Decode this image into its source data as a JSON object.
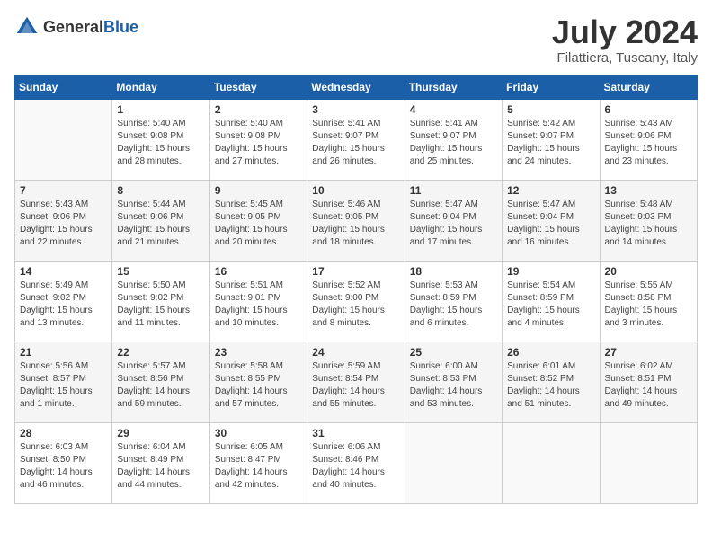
{
  "header": {
    "logo_general": "General",
    "logo_blue": "Blue",
    "month_year": "July 2024",
    "location": "Filattiera, Tuscany, Italy"
  },
  "days_of_week": [
    "Sunday",
    "Monday",
    "Tuesday",
    "Wednesday",
    "Thursday",
    "Friday",
    "Saturday"
  ],
  "weeks": [
    [
      {
        "num": "",
        "info": ""
      },
      {
        "num": "1",
        "info": "Sunrise: 5:40 AM\nSunset: 9:08 PM\nDaylight: 15 hours\nand 28 minutes."
      },
      {
        "num": "2",
        "info": "Sunrise: 5:40 AM\nSunset: 9:08 PM\nDaylight: 15 hours\nand 27 minutes."
      },
      {
        "num": "3",
        "info": "Sunrise: 5:41 AM\nSunset: 9:07 PM\nDaylight: 15 hours\nand 26 minutes."
      },
      {
        "num": "4",
        "info": "Sunrise: 5:41 AM\nSunset: 9:07 PM\nDaylight: 15 hours\nand 25 minutes."
      },
      {
        "num": "5",
        "info": "Sunrise: 5:42 AM\nSunset: 9:07 PM\nDaylight: 15 hours\nand 24 minutes."
      },
      {
        "num": "6",
        "info": "Sunrise: 5:43 AM\nSunset: 9:06 PM\nDaylight: 15 hours\nand 23 minutes."
      }
    ],
    [
      {
        "num": "7",
        "info": "Sunrise: 5:43 AM\nSunset: 9:06 PM\nDaylight: 15 hours\nand 22 minutes."
      },
      {
        "num": "8",
        "info": "Sunrise: 5:44 AM\nSunset: 9:06 PM\nDaylight: 15 hours\nand 21 minutes."
      },
      {
        "num": "9",
        "info": "Sunrise: 5:45 AM\nSunset: 9:05 PM\nDaylight: 15 hours\nand 20 minutes."
      },
      {
        "num": "10",
        "info": "Sunrise: 5:46 AM\nSunset: 9:05 PM\nDaylight: 15 hours\nand 18 minutes."
      },
      {
        "num": "11",
        "info": "Sunrise: 5:47 AM\nSunset: 9:04 PM\nDaylight: 15 hours\nand 17 minutes."
      },
      {
        "num": "12",
        "info": "Sunrise: 5:47 AM\nSunset: 9:04 PM\nDaylight: 15 hours\nand 16 minutes."
      },
      {
        "num": "13",
        "info": "Sunrise: 5:48 AM\nSunset: 9:03 PM\nDaylight: 15 hours\nand 14 minutes."
      }
    ],
    [
      {
        "num": "14",
        "info": "Sunrise: 5:49 AM\nSunset: 9:02 PM\nDaylight: 15 hours\nand 13 minutes."
      },
      {
        "num": "15",
        "info": "Sunrise: 5:50 AM\nSunset: 9:02 PM\nDaylight: 15 hours\nand 11 minutes."
      },
      {
        "num": "16",
        "info": "Sunrise: 5:51 AM\nSunset: 9:01 PM\nDaylight: 15 hours\nand 10 minutes."
      },
      {
        "num": "17",
        "info": "Sunrise: 5:52 AM\nSunset: 9:00 PM\nDaylight: 15 hours\nand 8 minutes."
      },
      {
        "num": "18",
        "info": "Sunrise: 5:53 AM\nSunset: 8:59 PM\nDaylight: 15 hours\nand 6 minutes."
      },
      {
        "num": "19",
        "info": "Sunrise: 5:54 AM\nSunset: 8:59 PM\nDaylight: 15 hours\nand 4 minutes."
      },
      {
        "num": "20",
        "info": "Sunrise: 5:55 AM\nSunset: 8:58 PM\nDaylight: 15 hours\nand 3 minutes."
      }
    ],
    [
      {
        "num": "21",
        "info": "Sunrise: 5:56 AM\nSunset: 8:57 PM\nDaylight: 15 hours\nand 1 minute."
      },
      {
        "num": "22",
        "info": "Sunrise: 5:57 AM\nSunset: 8:56 PM\nDaylight: 14 hours\nand 59 minutes."
      },
      {
        "num": "23",
        "info": "Sunrise: 5:58 AM\nSunset: 8:55 PM\nDaylight: 14 hours\nand 57 minutes."
      },
      {
        "num": "24",
        "info": "Sunrise: 5:59 AM\nSunset: 8:54 PM\nDaylight: 14 hours\nand 55 minutes."
      },
      {
        "num": "25",
        "info": "Sunrise: 6:00 AM\nSunset: 8:53 PM\nDaylight: 14 hours\nand 53 minutes."
      },
      {
        "num": "26",
        "info": "Sunrise: 6:01 AM\nSunset: 8:52 PM\nDaylight: 14 hours\nand 51 minutes."
      },
      {
        "num": "27",
        "info": "Sunrise: 6:02 AM\nSunset: 8:51 PM\nDaylight: 14 hours\nand 49 minutes."
      }
    ],
    [
      {
        "num": "28",
        "info": "Sunrise: 6:03 AM\nSunset: 8:50 PM\nDaylight: 14 hours\nand 46 minutes."
      },
      {
        "num": "29",
        "info": "Sunrise: 6:04 AM\nSunset: 8:49 PM\nDaylight: 14 hours\nand 44 minutes."
      },
      {
        "num": "30",
        "info": "Sunrise: 6:05 AM\nSunset: 8:47 PM\nDaylight: 14 hours\nand 42 minutes."
      },
      {
        "num": "31",
        "info": "Sunrise: 6:06 AM\nSunset: 8:46 PM\nDaylight: 14 hours\nand 40 minutes."
      },
      {
        "num": "",
        "info": ""
      },
      {
        "num": "",
        "info": ""
      },
      {
        "num": "",
        "info": ""
      }
    ]
  ]
}
